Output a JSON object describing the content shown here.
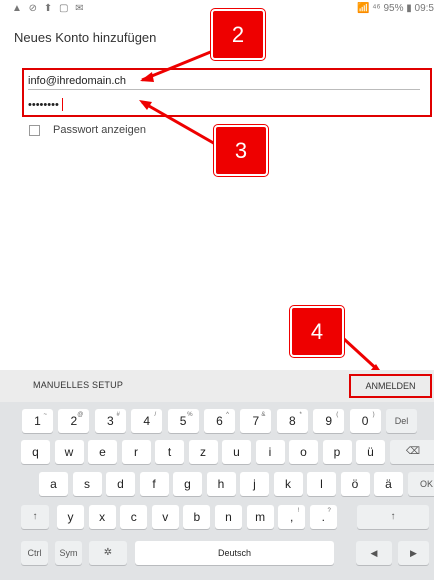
{
  "status_bar": {
    "left_icons": "▲ ⊘ ⬆ ▢ ✉",
    "right_text": "📶 ⁴⁶ 95% ▮ 09:5"
  },
  "header": {
    "title": "Neues Konto hinzufügen"
  },
  "form": {
    "email_value": "info@ihredomain.ch",
    "password_value": "••••••••",
    "show_password_label": "Passwort anzeigen",
    "show_password_checked": false
  },
  "callouts": {
    "two": "2",
    "three": "3",
    "four": "4"
  },
  "action_bar": {
    "manual_setup_label": "MANUELLES SETUP",
    "login_label": "ANMELDEN"
  },
  "keyboard": {
    "row1": [
      {
        "key": "1",
        "sup": "~"
      },
      {
        "key": "2",
        "sup": "@"
      },
      {
        "key": "3",
        "sup": "#"
      },
      {
        "key": "4",
        "sup": "/"
      },
      {
        "key": "5",
        "sup": "%"
      },
      {
        "key": "6",
        "sup": "^"
      },
      {
        "key": "7",
        "sup": "&"
      },
      {
        "key": "8",
        "sup": "*"
      },
      {
        "key": "9",
        "sup": "("
      },
      {
        "key": "0",
        "sup": ")"
      },
      {
        "key": "Del",
        "sup": ""
      }
    ],
    "row2": [
      "q",
      "w",
      "e",
      "r",
      "t",
      "z",
      "u",
      "i",
      "o",
      "p",
      "ü",
      "⌫"
    ],
    "row3": [
      "a",
      "s",
      "d",
      "f",
      "g",
      "h",
      "j",
      "k",
      "l",
      "ö",
      "ä",
      "OK"
    ],
    "row4": [
      "↑",
      "y",
      "x",
      "c",
      "v",
      "b",
      "n",
      "m",
      ",",
      ".",
      "↑"
    ],
    "row4_sups": [
      "",
      "",
      "",
      "",
      "",
      "",
      "",
      "",
      "!",
      "?",
      ""
    ],
    "row5": {
      "ctrl": "Ctrl",
      "sym": "Sym",
      "settings": "✲",
      "space": "Deutsch",
      "left": "◀",
      "right": "▶"
    }
  }
}
